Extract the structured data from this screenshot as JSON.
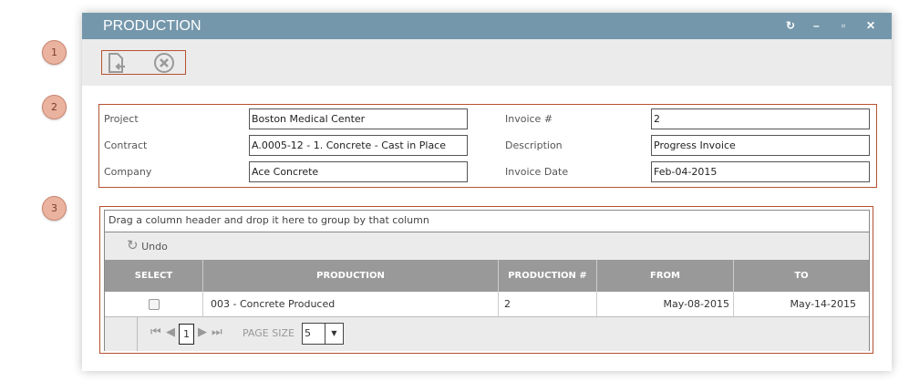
{
  "badges": [
    "1",
    "2",
    "3"
  ],
  "window": {
    "title": "PRODUCTION"
  },
  "form": {
    "project_label": "Project",
    "project": "Boston Medical Center",
    "contract_label": "Contract",
    "contract": "A.0005-12 - 1. Concrete - Cast in Place",
    "company_label": "Company",
    "company": "Ace Concrete",
    "invoice_label": "Invoice #",
    "invoice": "2",
    "description_label": "Description",
    "description": "Progress Invoice",
    "date_label": "Invoice Date",
    "date": "Feb-04-2015"
  },
  "grid": {
    "group_hint": "Drag a column header and drop it here to group by that column",
    "undo": "Undo",
    "columns": [
      "SELECT",
      "PRODUCTION",
      "PRODUCTION #",
      "FROM",
      "TO"
    ],
    "rows": [
      {
        "production": "003 - Concrete Produced",
        "number": "2",
        "from": "May-08-2015",
        "to": "May-14-2015",
        "selected": false
      }
    ],
    "page": "1",
    "page_size_label": "PAGE SIZE",
    "page_size": "5"
  }
}
